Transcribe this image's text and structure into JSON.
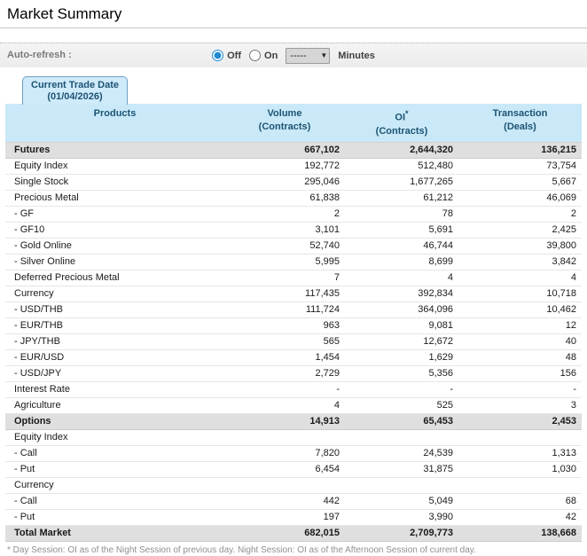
{
  "page": {
    "title": "Market Summary"
  },
  "refresh": {
    "label": "Auto-refresh :",
    "off_label": "Off",
    "on_label": "On",
    "selected": "Off",
    "interval_value": "-----",
    "unit_label": "Minutes"
  },
  "tab": {
    "line1": "Current Trade Date",
    "line2": "(01/04/2026)"
  },
  "table": {
    "columns": [
      {
        "label": "Products",
        "sub": ""
      },
      {
        "label": "Volume",
        "sub": "(Contracts)"
      },
      {
        "label": "OI",
        "sup": "*",
        "sub": "(Contracts)"
      },
      {
        "label": "Transaction",
        "sub": "(Deals)"
      }
    ],
    "rows": [
      {
        "product": "Futures",
        "volume": "667,102",
        "oi": "2,644,320",
        "deals": "136,215",
        "type": "section"
      },
      {
        "product": "Equity Index",
        "volume": "192,772",
        "oi": "512,480",
        "deals": "73,754",
        "type": "item"
      },
      {
        "product": "Single Stock",
        "volume": "295,046",
        "oi": "1,677,265",
        "deals": "5,667",
        "type": "item"
      },
      {
        "product": "Precious Metal",
        "volume": "61,838",
        "oi": "61,212",
        "deals": "46,069",
        "type": "item"
      },
      {
        "product": "- GF",
        "volume": "2",
        "oi": "78",
        "deals": "2",
        "type": "item"
      },
      {
        "product": "- GF10",
        "volume": "3,101",
        "oi": "5,691",
        "deals": "2,425",
        "type": "item"
      },
      {
        "product": "- Gold Online",
        "volume": "52,740",
        "oi": "46,744",
        "deals": "39,800",
        "type": "item"
      },
      {
        "product": "- Silver Online",
        "volume": "5,995",
        "oi": "8,699",
        "deals": "3,842",
        "type": "item"
      },
      {
        "product": "Deferred Precious Metal",
        "volume": "7",
        "oi": "4",
        "deals": "4",
        "type": "item"
      },
      {
        "product": "Currency",
        "volume": "117,435",
        "oi": "392,834",
        "deals": "10,718",
        "type": "item"
      },
      {
        "product": "- USD/THB",
        "volume": "111,724",
        "oi": "364,096",
        "deals": "10,462",
        "type": "item"
      },
      {
        "product": "- EUR/THB",
        "volume": "963",
        "oi": "9,081",
        "deals": "12",
        "type": "item"
      },
      {
        "product": "- JPY/THB",
        "volume": "565",
        "oi": "12,672",
        "deals": "40",
        "type": "item"
      },
      {
        "product": "- EUR/USD",
        "volume": "1,454",
        "oi": "1,629",
        "deals": "48",
        "type": "item"
      },
      {
        "product": "- USD/JPY",
        "volume": "2,729",
        "oi": "5,356",
        "deals": "156",
        "type": "item"
      },
      {
        "product": "Interest Rate",
        "volume": "-",
        "oi": "-",
        "deals": "-",
        "type": "item"
      },
      {
        "product": "Agriculture",
        "volume": "4",
        "oi": "525",
        "deals": "3",
        "type": "item"
      },
      {
        "product": "Options",
        "volume": "14,913",
        "oi": "65,453",
        "deals": "2,453",
        "type": "section"
      },
      {
        "product": "Equity Index",
        "volume": "",
        "oi": "",
        "deals": "",
        "type": "item"
      },
      {
        "product": "- Call",
        "volume": "7,820",
        "oi": "24,539",
        "deals": "1,313",
        "type": "item"
      },
      {
        "product": "- Put",
        "volume": "6,454",
        "oi": "31,875",
        "deals": "1,030",
        "type": "item"
      },
      {
        "product": "Currency",
        "volume": "",
        "oi": "",
        "deals": "",
        "type": "item"
      },
      {
        "product": "- Call",
        "volume": "442",
        "oi": "5,049",
        "deals": "68",
        "type": "item"
      },
      {
        "product": "- Put",
        "volume": "197",
        "oi": "3,990",
        "deals": "42",
        "type": "item"
      },
      {
        "product": "Total Market",
        "volume": "682,015",
        "oi": "2,709,773",
        "deals": "138,668",
        "type": "section"
      }
    ]
  },
  "footnote": "* Day Session: OI as of the Night Session of previous day. Night Session: OI as of the Afternoon Session of current day.",
  "colors": {
    "header_bg": "#c9e9f8",
    "header_text": "#1c5373",
    "tab_bg": "#cfeafa",
    "tab_border": "#6f9fc0",
    "section_row_bg": "#dfdfdf",
    "bar_bg": "#ececec",
    "muted_text": "#8f8f8f",
    "radio_accent": "#1e8ad2"
  }
}
